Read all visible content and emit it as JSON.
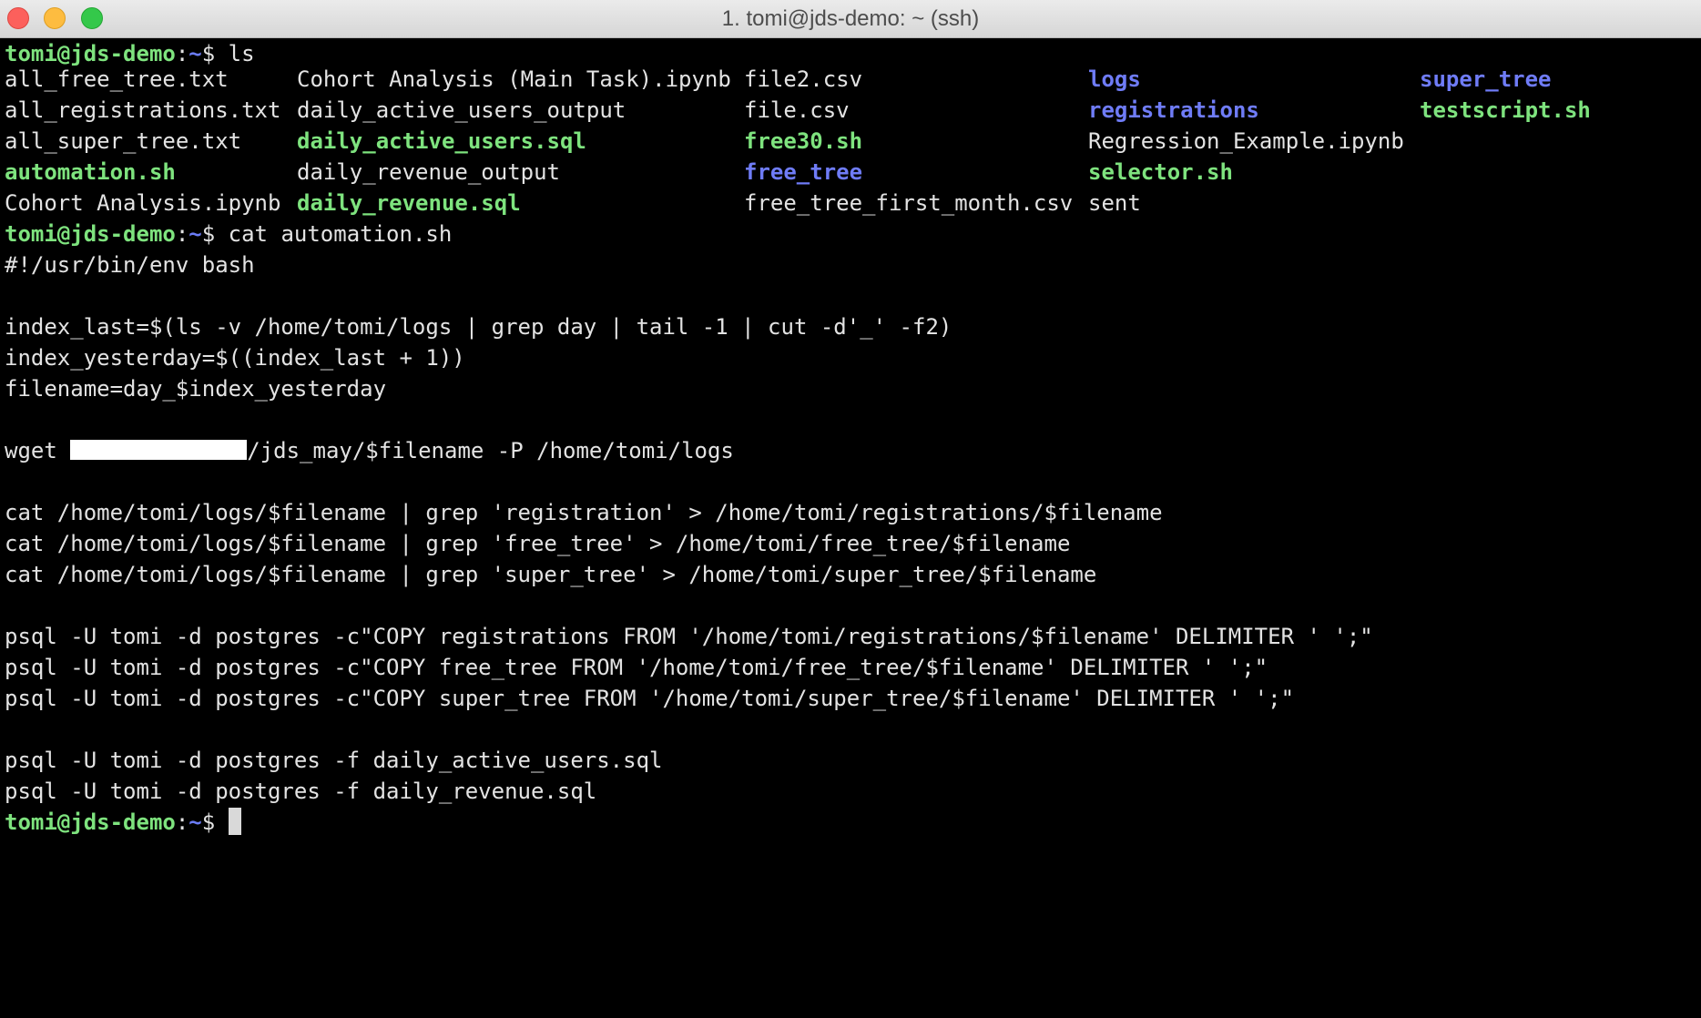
{
  "window": {
    "title": "1. tomi@jds-demo: ~ (ssh)"
  },
  "prompt": {
    "host": "tomi@jds-demo",
    "sep": ":",
    "path": "~",
    "symbol": "$ "
  },
  "commands": {
    "ls": "ls",
    "cat": "cat automation.sh"
  },
  "ls_listing": {
    "col1": [
      "all_free_tree.txt",
      "all_registrations.txt",
      "all_super_tree.txt",
      "automation.sh",
      "Cohort Analysis.ipynb"
    ],
    "col2": [
      "Cohort Analysis (Main Task).ipynb",
      "daily_active_users_output",
      "daily_active_users.sql",
      "daily_revenue_output",
      "daily_revenue.sql"
    ],
    "col3": [
      "file2.csv",
      "file.csv",
      "free30.sh",
      "free_tree",
      "free_tree_first_month.csv"
    ],
    "col4": [
      "logs",
      "registrations",
      "Regression_Example.ipynb",
      "selector.sh",
      "sent"
    ],
    "col5": [
      "super_tree",
      "testscript.sh"
    ]
  },
  "script": {
    "shebang": "#!/usr/bin/env bash",
    "index_last": "index_last=$(ls -v /home/tomi/logs | grep day | tail -1 | cut -d'_' -f2)",
    "index_yesterday": "index_yesterday=$((index_last + 1))",
    "filename": "filename=day_$index_yesterday",
    "wget_prefix": "wget ",
    "wget_suffix": "/jds_may/$filename -P /home/tomi/logs",
    "cat1": "cat /home/tomi/logs/$filename | grep 'registration' > /home/tomi/registrations/$filename",
    "cat2": "cat /home/tomi/logs/$filename | grep 'free_tree' > /home/tomi/free_tree/$filename",
    "cat3": "cat /home/tomi/logs/$filename | grep 'super_tree' > /home/tomi/super_tree/$filename",
    "psql1": "psql -U tomi -d postgres -c\"COPY registrations FROM '/home/tomi/registrations/$filename' DELIMITER ' ';\"",
    "psql2": "psql -U tomi -d postgres -c\"COPY free_tree FROM '/home/tomi/free_tree/$filename' DELIMITER ' ';\"",
    "psql3": "psql -U tomi -d postgres -c\"COPY super_tree FROM '/home/tomi/super_tree/$filename' DELIMITER ' ';\"",
    "psql4": "psql -U tomi -d postgres -f daily_active_users.sql",
    "psql5": "psql -U tomi -d postgres -f daily_revenue.sql"
  },
  "colors": {
    "background": "#000000",
    "text": "#e3e3e3",
    "executable": "#7ee37e",
    "directory": "#6f7cf7",
    "prompt_host": "#7ee37e",
    "prompt_path": "#6b7cf6"
  }
}
